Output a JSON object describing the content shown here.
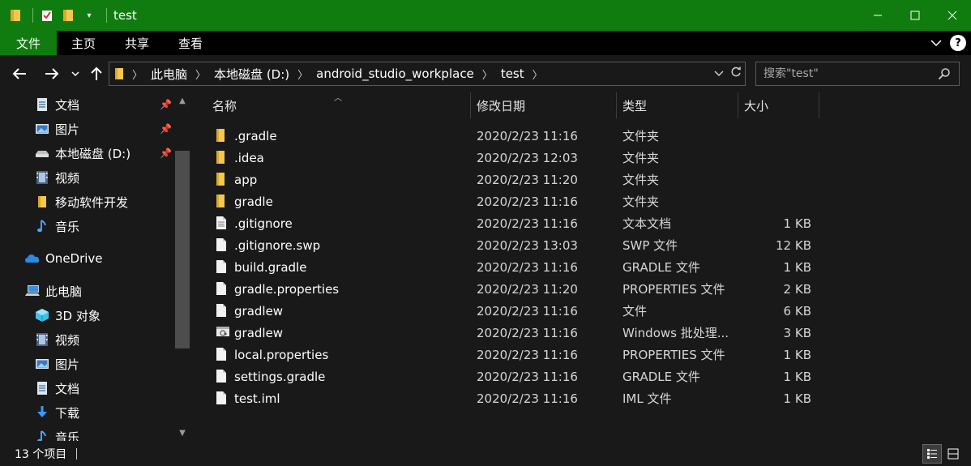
{
  "window": {
    "title": "test",
    "controls": [
      "minimize-icon",
      "maximize-icon",
      "close-icon"
    ],
    "accent": "#107c10"
  },
  "ribbon": {
    "tabs": [
      {
        "label": "文件",
        "active": true
      },
      {
        "label": "主页"
      },
      {
        "label": "共享"
      },
      {
        "label": "查看"
      }
    ]
  },
  "address": {
    "crumbs": [
      "此电脑",
      "本地磁盘 (D:)",
      "android_studio_workplace",
      "test"
    ]
  },
  "search": {
    "placeholder": "搜索\"test\""
  },
  "nav": {
    "items": [
      {
        "label": "文档",
        "icon": "documents-icon",
        "pinned": true
      },
      {
        "label": "图片",
        "icon": "pictures-icon",
        "pinned": true
      },
      {
        "label": "本地磁盘 (D:)",
        "icon": "drive-icon",
        "pinned": true
      },
      {
        "label": "视频",
        "icon": "videos-icon"
      },
      {
        "label": "移动软件开发",
        "icon": "folder-icon"
      },
      {
        "label": "音乐",
        "icon": "music-icon"
      },
      {
        "label": "OneDrive",
        "icon": "onedrive-icon"
      },
      {
        "label": "此电脑",
        "icon": "this-pc-icon"
      },
      {
        "label": "3D 对象",
        "icon": "3d-objects-icon"
      },
      {
        "label": "视频",
        "icon": "videos-icon"
      },
      {
        "label": "图片",
        "icon": "pictures-icon"
      },
      {
        "label": "文档",
        "icon": "documents-icon"
      },
      {
        "label": "下载",
        "icon": "downloads-icon"
      },
      {
        "label": "音乐",
        "icon": "music-icon"
      }
    ]
  },
  "columns": {
    "name": "名称",
    "modified": "修改日期",
    "type": "类型",
    "size": "大小"
  },
  "files": [
    {
      "name": ".gradle",
      "modified": "2020/2/23 11:16",
      "type": "文件夹",
      "size": "",
      "icon": "folder-icon"
    },
    {
      "name": ".idea",
      "modified": "2020/2/23 12:03",
      "type": "文件夹",
      "size": "",
      "icon": "folder-icon"
    },
    {
      "name": "app",
      "modified": "2020/2/23 11:20",
      "type": "文件夹",
      "size": "",
      "icon": "folder-icon"
    },
    {
      "name": "gradle",
      "modified": "2020/2/23 11:16",
      "type": "文件夹",
      "size": "",
      "icon": "folder-icon"
    },
    {
      "name": ".gitignore",
      "modified": "2020/2/23 11:16",
      "type": "文本文档",
      "size": "1 KB",
      "icon": "text-file-icon"
    },
    {
      "name": ".gitignore.swp",
      "modified": "2020/2/23 13:03",
      "type": "SWP 文件",
      "size": "12 KB",
      "icon": "file-icon"
    },
    {
      "name": "build.gradle",
      "modified": "2020/2/23 11:16",
      "type": "GRADLE 文件",
      "size": "1 KB",
      "icon": "file-icon"
    },
    {
      "name": "gradle.properties",
      "modified": "2020/2/23 11:20",
      "type": "PROPERTIES 文件",
      "size": "2 KB",
      "icon": "file-icon"
    },
    {
      "name": "gradlew",
      "modified": "2020/2/23 11:16",
      "type": "文件",
      "size": "6 KB",
      "icon": "file-icon"
    },
    {
      "name": "gradlew",
      "modified": "2020/2/23 11:16",
      "type": "Windows 批处理...",
      "size": "3 KB",
      "icon": "batch-file-icon"
    },
    {
      "name": "local.properties",
      "modified": "2020/2/23 11:16",
      "type": "PROPERTIES 文件",
      "size": "1 KB",
      "icon": "file-icon"
    },
    {
      "name": "settings.gradle",
      "modified": "2020/2/23 11:16",
      "type": "GRADLE 文件",
      "size": "1 KB",
      "icon": "file-icon"
    },
    {
      "name": "test.iml",
      "modified": "2020/2/23 11:16",
      "type": "IML 文件",
      "size": "1 KB",
      "icon": "file-icon"
    }
  ],
  "status": {
    "count": "13 个项目"
  }
}
